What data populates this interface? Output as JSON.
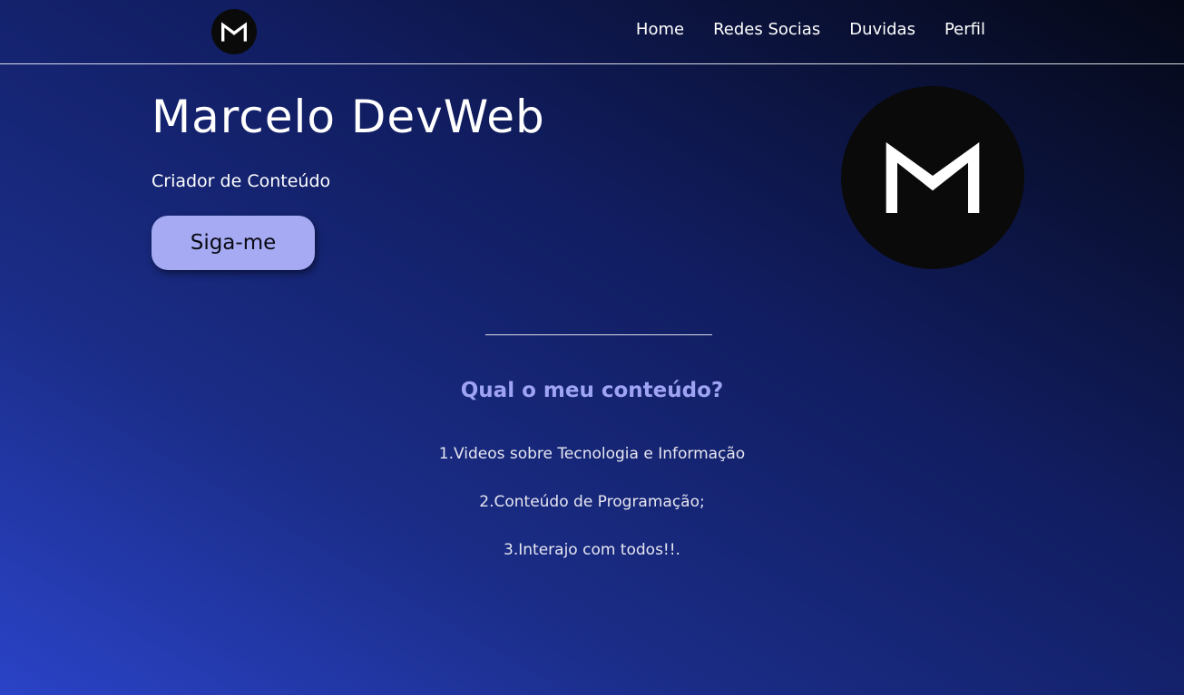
{
  "nav": {
    "logo_icon": "m-logo-icon",
    "links": [
      "Home",
      "Redes Socias",
      "Duvidas",
      "Perfil"
    ]
  },
  "hero": {
    "title": "Marcelo DevWeb",
    "subtitle": "Criador de Conteúdo",
    "button_label": "Siga-me",
    "avatar_icon": "m-logo-icon"
  },
  "content": {
    "heading": "Qual o meu conteúdo?",
    "items": [
      "1.Videos sobre Tecnologia e Informação",
      "2.Conteúdo de Programação;",
      "3.Interajo com todos!!."
    ]
  },
  "colors": {
    "button_bg": "#a5aaf3",
    "heading": "#9ea3f3",
    "logo_bg": "#0a0a0a"
  }
}
